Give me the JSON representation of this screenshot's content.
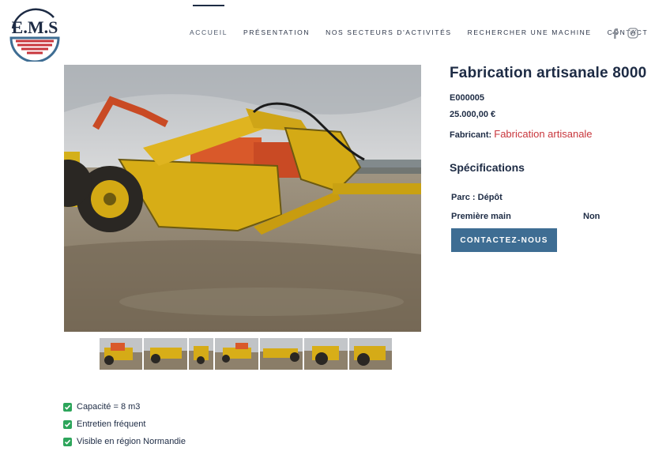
{
  "brand": {
    "logo_text": "EMS",
    "colors": {
      "navy": "#1d2b44",
      "red": "#c8363c",
      "blue": "#3e6d93",
      "green": "#2da55b"
    }
  },
  "nav": {
    "items": [
      {
        "label": "ACCUEIL",
        "active": true
      },
      {
        "label": "PRÉSENTATION",
        "active": false
      },
      {
        "label": "NOS SECTEURS D'ACTIVITÉS",
        "active": false
      },
      {
        "label": "RECHERCHER UNE MACHINE",
        "active": false
      },
      {
        "label": "CONTACT",
        "active": false
      }
    ],
    "social": [
      "facebook-icon",
      "instagram-icon"
    ]
  },
  "product": {
    "title": "Fabrication artisanale 8000",
    "reference": "E000005",
    "price": "25.000,00 €",
    "manufacturer_label": "Fabricant:",
    "manufacturer": "Fabrication artisanale",
    "specs_title": "Spécifications",
    "specs": [
      {
        "label": "Parc : Dépôt",
        "value": ""
      },
      {
        "label": "Première main",
        "value": "Non"
      }
    ],
    "cta": "CONTACTEZ-NOUS",
    "thumbnail_count": 7
  },
  "features": [
    "Capacité = 8 m3",
    "Entretien fréquent",
    "Visible en région Normandie"
  ]
}
